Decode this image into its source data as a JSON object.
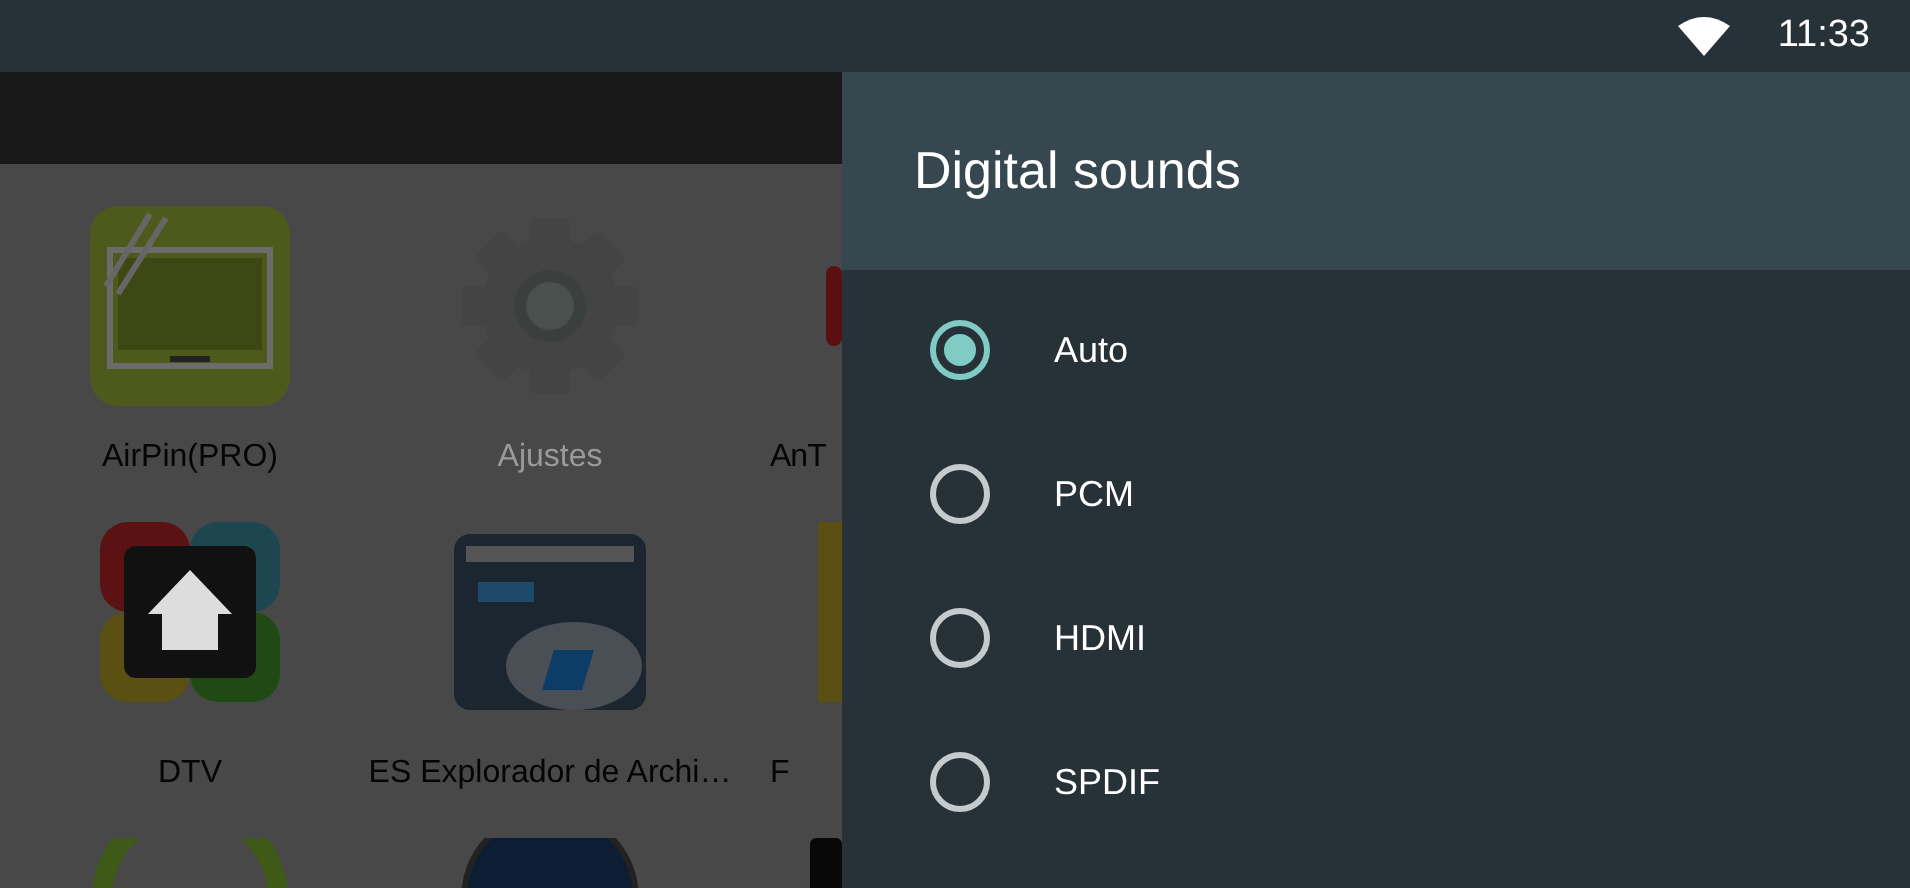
{
  "status_bar": {
    "time": "11:33"
  },
  "apps": [
    {
      "label": "AirPin(PRO)",
      "kind": "airpin",
      "faded": false
    },
    {
      "label": "Ajustes",
      "kind": "gear",
      "faded": true
    },
    {
      "label": "AnT",
      "kind": "redcircle",
      "faded": false
    },
    {
      "label": "DTV",
      "kind": "dtv",
      "faded": false
    },
    {
      "label": "ES Explorador de Archi…",
      "kind": "folder",
      "faded": false
    },
    {
      "label": "F",
      "kind": "yellow",
      "faded": false
    },
    {
      "kind": "ring"
    },
    {
      "kind": "bluecircle"
    },
    {
      "kind": "black"
    }
  ],
  "dialog": {
    "title": "Digital sounds",
    "options": [
      {
        "label": "Auto",
        "selected": true
      },
      {
        "label": "PCM",
        "selected": false
      },
      {
        "label": "HDMI",
        "selected": false
      },
      {
        "label": "SPDIF",
        "selected": false
      }
    ]
  }
}
